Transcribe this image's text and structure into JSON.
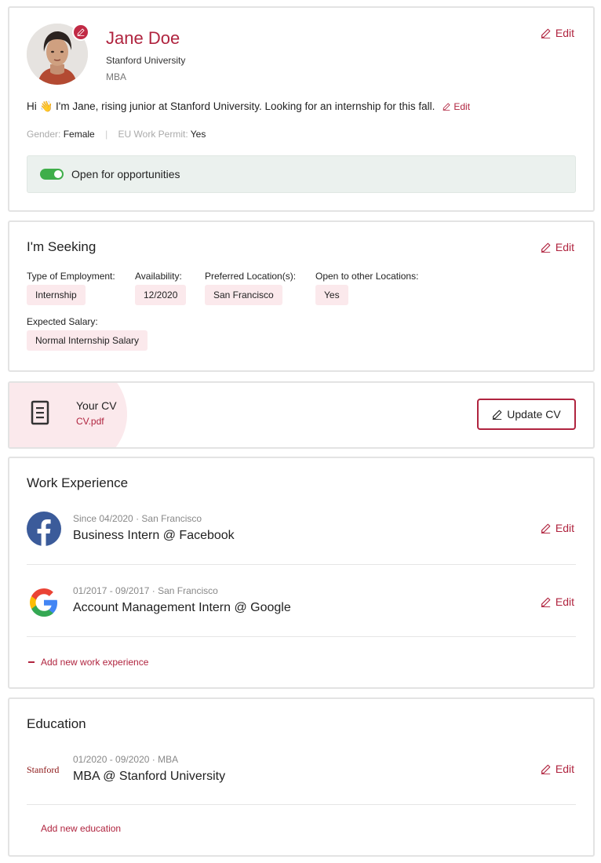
{
  "profile": {
    "name": "Jane Doe",
    "school": "Stanford University",
    "degree": "MBA",
    "edit_label": "Edit",
    "bio": "Hi 👋 I'm Jane, rising junior at Stanford University. Looking for an internship for this fall.",
    "bio_edit_label": "Edit",
    "gender_label": "Gender:",
    "gender_value": "Female",
    "permit_label": "EU Work Permit:",
    "permit_value": "Yes",
    "opportunities_label": "Open for opportunities",
    "opportunities_on": true
  },
  "seeking": {
    "title": "I'm Seeking",
    "edit_label": "Edit",
    "fields": [
      {
        "label": "Type of Employment:",
        "value": "Internship"
      },
      {
        "label": "Availability:",
        "value": "12/2020"
      },
      {
        "label": "Preferred Location(s):",
        "value": "San Francisco"
      },
      {
        "label": "Open to other Locations:",
        "value": "Yes"
      },
      {
        "label": "Expected Salary:",
        "value": "Normal Internship Salary"
      }
    ]
  },
  "cv": {
    "title": "Your CV",
    "file": "CV.pdf",
    "button_label": "Update CV"
  },
  "work": {
    "title": "Work Experience",
    "items": [
      {
        "meta": "Since 04/2020 · San Francisco",
        "title": "Business Intern @ Facebook",
        "edit_label": "Edit",
        "logo": "facebook-logo"
      },
      {
        "meta": "01/2017 - 09/2017 · San Francisco",
        "title": "Account Management Intern @ Google",
        "edit_label": "Edit",
        "logo": "google-logo"
      }
    ],
    "add_label": "Add new work experience"
  },
  "education": {
    "title": "Education",
    "items": [
      {
        "meta": "01/2020 - 09/2020 · MBA",
        "title": "MBA @ Stanford University",
        "edit_label": "Edit",
        "logo_text": "Stanford"
      }
    ],
    "add_label": "Add new education"
  },
  "colors": {
    "accent": "#b0243f",
    "chip": "#fbe9ec",
    "toggle": "#3fae4a"
  }
}
